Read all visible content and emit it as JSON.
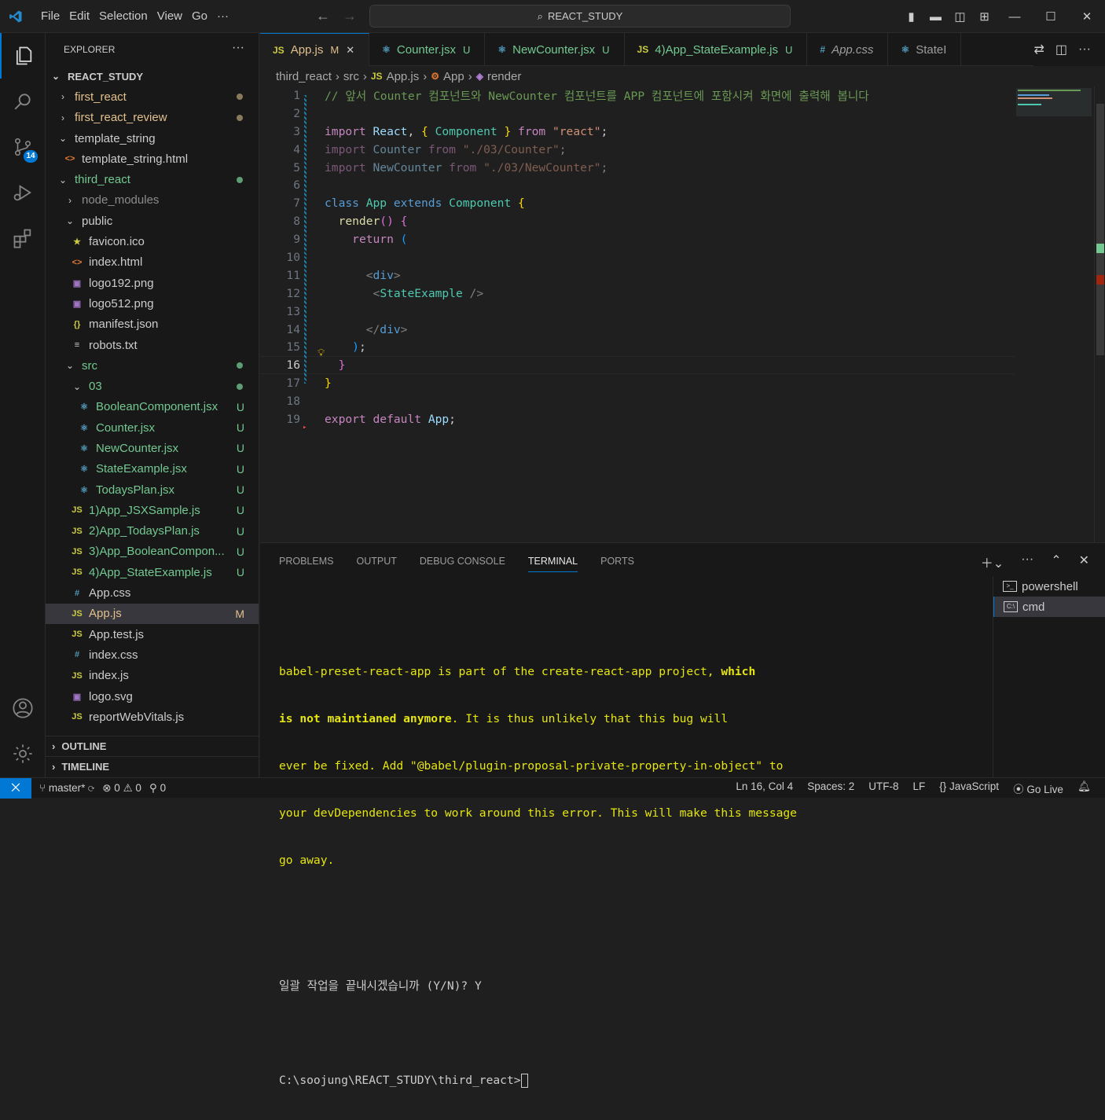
{
  "titlebar": {
    "menu": [
      "File",
      "Edit",
      "Selection",
      "View",
      "Go",
      "···"
    ],
    "search": "REACT_STUDY"
  },
  "activity": {
    "scm_badge": "14"
  },
  "explorer": {
    "title": "EXPLORER",
    "root": "REACT_STUDY",
    "items": [
      {
        "label": "first_react",
        "chev": "›",
        "indent": 1,
        "status": "dot-mod",
        "color": "mod"
      },
      {
        "label": "first_react_review",
        "chev": "›",
        "indent": 1,
        "status": "dot-mod",
        "color": "mod"
      },
      {
        "label": "template_string",
        "chev": "⌄",
        "indent": 1,
        "status": "",
        "color": ""
      },
      {
        "label": "template_string.html",
        "icon": "<>",
        "iconColor": "#e37933",
        "indent": 2,
        "status": "",
        "color": ""
      },
      {
        "label": "third_react",
        "chev": "⌄",
        "indent": 1,
        "status": "dot-green",
        "color": "green"
      },
      {
        "label": "node_modules",
        "chev": "›",
        "indent": 2,
        "status": "",
        "color": "dim"
      },
      {
        "label": "public",
        "chev": "⌄",
        "indent": 2,
        "status": "",
        "color": ""
      },
      {
        "label": "favicon.ico",
        "icon": "★",
        "iconColor": "#cbcb41",
        "indent": 3,
        "status": "",
        "color": ""
      },
      {
        "label": "index.html",
        "icon": "<>",
        "iconColor": "#e37933",
        "indent": 3,
        "status": "",
        "color": ""
      },
      {
        "label": "logo192.png",
        "icon": "▣",
        "iconColor": "#a074c4",
        "indent": 3,
        "status": "",
        "color": ""
      },
      {
        "label": "logo512.png",
        "icon": "▣",
        "iconColor": "#a074c4",
        "indent": 3,
        "status": "",
        "color": ""
      },
      {
        "label": "manifest.json",
        "icon": "{}",
        "iconColor": "#cbcb41",
        "indent": 3,
        "status": "",
        "color": ""
      },
      {
        "label": "robots.txt",
        "icon": "≡",
        "iconColor": "#cccccc",
        "indent": 3,
        "status": "",
        "color": ""
      },
      {
        "label": "src",
        "chev": "⌄",
        "indent": 2,
        "status": "dot-green",
        "color": "green"
      },
      {
        "label": "03",
        "chev": "⌄",
        "indent": 3,
        "status": "dot-green",
        "color": "green"
      },
      {
        "label": "BooleanComponent.jsx",
        "icon": "⚛",
        "iconColor": "#519aba",
        "indent": 4,
        "status": "U",
        "color": "green"
      },
      {
        "label": "Counter.jsx",
        "icon": "⚛",
        "iconColor": "#519aba",
        "indent": 4,
        "status": "U",
        "color": "green"
      },
      {
        "label": "NewCounter.jsx",
        "icon": "⚛",
        "iconColor": "#519aba",
        "indent": 4,
        "status": "U",
        "color": "green"
      },
      {
        "label": "StateExample.jsx",
        "icon": "⚛",
        "iconColor": "#519aba",
        "indent": 4,
        "status": "U",
        "color": "green"
      },
      {
        "label": "TodaysPlan.jsx",
        "icon": "⚛",
        "iconColor": "#519aba",
        "indent": 4,
        "status": "U",
        "color": "green"
      },
      {
        "label": "1)App_JSXSample.js",
        "icon": "JS",
        "iconColor": "#cbcb41",
        "indent": 3,
        "status": "U",
        "color": "green"
      },
      {
        "label": "2)App_TodaysPlan.js",
        "icon": "JS",
        "iconColor": "#cbcb41",
        "indent": 3,
        "status": "U",
        "color": "green"
      },
      {
        "label": "3)App_BooleanCompon...",
        "icon": "JS",
        "iconColor": "#cbcb41",
        "indent": 3,
        "status": "U",
        "color": "green"
      },
      {
        "label": "4)App_StateExample.js",
        "icon": "JS",
        "iconColor": "#cbcb41",
        "indent": 3,
        "status": "U",
        "color": "green"
      },
      {
        "label": "App.css",
        "icon": "#",
        "iconColor": "#519aba",
        "indent": 3,
        "status": "",
        "color": ""
      },
      {
        "label": "App.js",
        "icon": "JS",
        "iconColor": "#cbcb41",
        "indent": 3,
        "status": "M",
        "color": "mod",
        "selected": true
      },
      {
        "label": "App.test.js",
        "icon": "JS",
        "iconColor": "#cbcb41",
        "indent": 3,
        "status": "",
        "color": ""
      },
      {
        "label": "index.css",
        "icon": "#",
        "iconColor": "#519aba",
        "indent": 3,
        "status": "",
        "color": ""
      },
      {
        "label": "index.js",
        "icon": "JS",
        "iconColor": "#cbcb41",
        "indent": 3,
        "status": "",
        "color": ""
      },
      {
        "label": "logo.svg",
        "icon": "▣",
        "iconColor": "#a074c4",
        "indent": 3,
        "status": "",
        "color": ""
      },
      {
        "label": "reportWebVitals.js",
        "icon": "JS",
        "iconColor": "#cbcb41",
        "indent": 3,
        "status": "",
        "color": ""
      }
    ],
    "outline": "OUTLINE",
    "timeline": "TIMELINE"
  },
  "tabs": [
    {
      "label": "App.js",
      "icon": "JS",
      "iconColor": "#cbcb41",
      "status": "M",
      "statusColor": "#e2c08d",
      "active": true,
      "close": "✕"
    },
    {
      "label": "Counter.jsx",
      "icon": "⚛",
      "iconColor": "#519aba",
      "status": "U",
      "statusColor": "#73c991"
    },
    {
      "label": "NewCounter.jsx",
      "icon": "⚛",
      "iconColor": "#519aba",
      "status": "U",
      "statusColor": "#73c991"
    },
    {
      "label": "4)App_StateExample.js",
      "icon": "JS",
      "iconColor": "#cbcb41",
      "status": "U",
      "statusColor": "#73c991"
    },
    {
      "label": "App.css",
      "icon": "#",
      "iconColor": "#519aba",
      "status": "",
      "statusColor": "",
      "italic": true
    },
    {
      "label": "StateI",
      "icon": "⚛",
      "iconColor": "#519aba",
      "status": "",
      "statusColor": ""
    }
  ],
  "breadcrumb": [
    "third_react",
    "src",
    "App.js",
    "App",
    "render"
  ],
  "code": {
    "current_line": 16,
    "lines": [
      [
        [
          "cm",
          "// 앞서 Counter 컴포넌트와 NewCounter 컴포넌트를 APP 컴포넌트에 포함시켜 화면에 출력해 봅니다"
        ]
      ],
      [],
      [
        [
          "kw2",
          "import "
        ],
        [
          "var",
          "React"
        ],
        [
          "txt",
          ", "
        ],
        [
          "br1",
          "{ "
        ],
        [
          "cls",
          "Component"
        ],
        [
          "br1",
          " }"
        ],
        [
          "kw2",
          " from "
        ],
        [
          "str",
          "\"react\""
        ],
        [
          "txt",
          ";"
        ]
      ],
      [
        [
          "kw2 dimmed",
          "import "
        ],
        [
          "var dimmed",
          "Counter"
        ],
        [
          "kw2 dimmed",
          " from "
        ],
        [
          "str dimmed",
          "\"./03/Counter\""
        ],
        [
          "txt dimmed",
          ";"
        ]
      ],
      [
        [
          "kw2 dimmed",
          "import "
        ],
        [
          "var dimmed",
          "NewCounter"
        ],
        [
          "kw2 dimmed",
          " from "
        ],
        [
          "str dimmed",
          "\"./03/NewCounter\""
        ],
        [
          "txt dimmed",
          ";"
        ]
      ],
      [],
      [
        [
          "kw",
          "class "
        ],
        [
          "cls",
          "App "
        ],
        [
          "kw",
          "extends "
        ],
        [
          "cls",
          "Component "
        ],
        [
          "br1",
          "{"
        ]
      ],
      [
        [
          "txt",
          "  "
        ],
        [
          "fn",
          "render"
        ],
        [
          "br2",
          "()"
        ],
        [
          "txt",
          " "
        ],
        [
          "br2",
          "{"
        ]
      ],
      [
        [
          "txt",
          "    "
        ],
        [
          "kw2",
          "return "
        ],
        [
          "br3",
          "("
        ]
      ],
      [],
      [
        [
          "txt",
          "      "
        ],
        [
          "pun",
          "<"
        ],
        [
          "tag",
          "div"
        ],
        [
          "pun",
          ">"
        ]
      ],
      [
        [
          "txt",
          "       "
        ],
        [
          "pun",
          "<"
        ],
        [
          "tagn",
          "StateExample"
        ],
        [
          "pun",
          " />"
        ]
      ],
      [],
      [
        [
          "txt",
          "      "
        ],
        [
          "pun",
          "</"
        ],
        [
          "tag",
          "div"
        ],
        [
          "pun",
          ">"
        ]
      ],
      [
        [
          "txt",
          "    "
        ],
        [
          "br3",
          ")"
        ],
        [
          "txt",
          ";"
        ]
      ],
      [
        [
          "txt",
          "  "
        ],
        [
          "br2",
          "}"
        ]
      ],
      [
        [
          "br1",
          "}"
        ]
      ],
      [],
      [
        [
          "kw2",
          "export "
        ],
        [
          "kw2",
          "default "
        ],
        [
          "var",
          "App"
        ],
        [
          "txt",
          ";"
        ]
      ]
    ]
  },
  "panel": {
    "tabs": [
      "PROBLEMS",
      "OUTPUT",
      "DEBUG CONSOLE",
      "TERMINAL",
      "PORTS"
    ],
    "active_tab": "TERMINAL",
    "terminal": {
      "warning_lines": [
        "babel-preset-react-app is part of the create-react-app project, which",
        "is not maintianed anymore. It is thus unlikely that this bug will",
        "ever be fixed. Add \"@babel/plugin-proposal-private-property-in-object\" to",
        "your devDependencies to work around this error. This will make this message",
        "go away."
      ],
      "prompt_question": "일괄 작업을 끝내시겠습니까 (Y/N)? Y",
      "cwd_prompt": "C:\\soojung\\REACT_STUDY\\third_react>"
    },
    "terminals": [
      "powershell",
      "cmd"
    ]
  },
  "statusbar": {
    "branch": "master*",
    "errors": "0",
    "warnings": "0",
    "ports": "0",
    "position": "Ln 16, Col 4",
    "spaces": "Spaces: 2",
    "encoding": "UTF-8",
    "eol": "LF",
    "language": "JavaScript",
    "golive": "Go Live"
  }
}
